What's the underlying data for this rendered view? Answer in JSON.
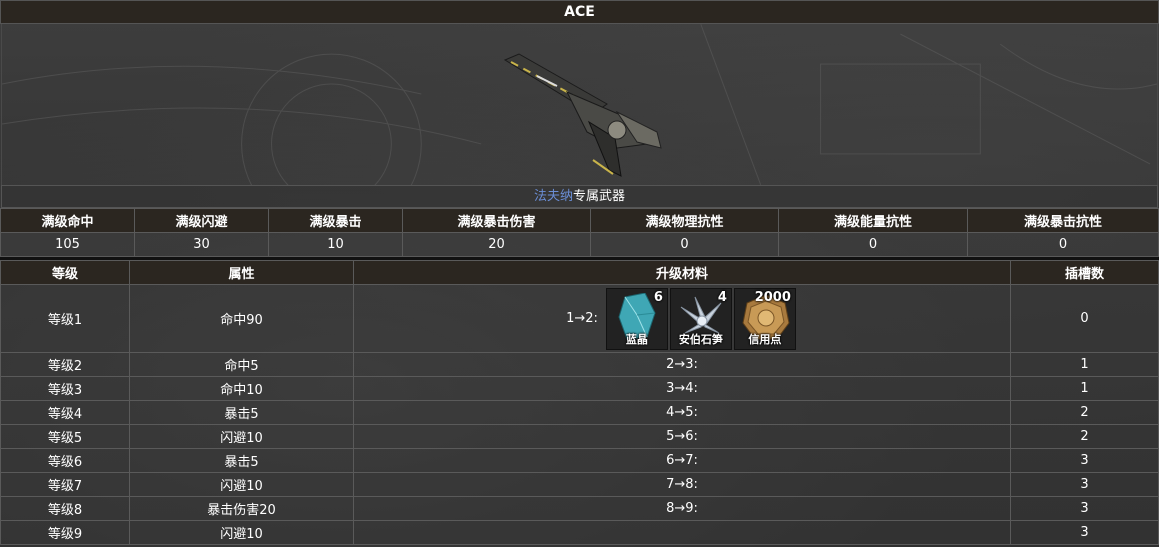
{
  "weapon": {
    "name": "ACE",
    "owner_link": "法夫纳",
    "owner_suffix": "专属武器"
  },
  "stats": {
    "headers": [
      "满级命中",
      "满级闪避",
      "满级暴击",
      "满级暴击伤害",
      "满级物理抗性",
      "满级能量抗性",
      "满级暴击抗性"
    ],
    "values": [
      "105",
      "30",
      "10",
      "20",
      "0",
      "0",
      "0"
    ]
  },
  "levels": {
    "headers": [
      "等级",
      "属性",
      "升级材料",
      "插槽数"
    ],
    "rows": [
      {
        "level": "等级1",
        "attr": "命中90",
        "upgrade": "1→2:",
        "slots": "0"
      },
      {
        "level": "等级2",
        "attr": "命中5",
        "upgrade": "2→3:",
        "slots": "1"
      },
      {
        "level": "等级3",
        "attr": "命中10",
        "upgrade": "3→4:",
        "slots": "1"
      },
      {
        "level": "等级4",
        "attr": "暴击5",
        "upgrade": "4→5:",
        "slots": "2"
      },
      {
        "level": "等级5",
        "attr": "闪避10",
        "upgrade": "5→6:",
        "slots": "2"
      },
      {
        "level": "等级6",
        "attr": "暴击5",
        "upgrade": "6→7:",
        "slots": "3"
      },
      {
        "level": "等级7",
        "attr": "闪避10",
        "upgrade": "7→8:",
        "slots": "3"
      },
      {
        "level": "等级8",
        "attr": "暴击伤害20",
        "upgrade": "8→9:",
        "slots": "3"
      },
      {
        "level": "等级9",
        "attr": "闪避10",
        "upgrade": "",
        "slots": "3"
      }
    ],
    "materials": [
      {
        "name": "蓝晶",
        "count": "6",
        "icon": "blue-crystal-icon"
      },
      {
        "name": "安伯石笋",
        "count": "4",
        "icon": "stalagmite-icon"
      },
      {
        "name": "信用点",
        "count": "2000",
        "icon": "credit-coin-icon"
      }
    ]
  },
  "colors": {
    "header_bg": "#2b2620",
    "link": "#6b8ed6"
  }
}
